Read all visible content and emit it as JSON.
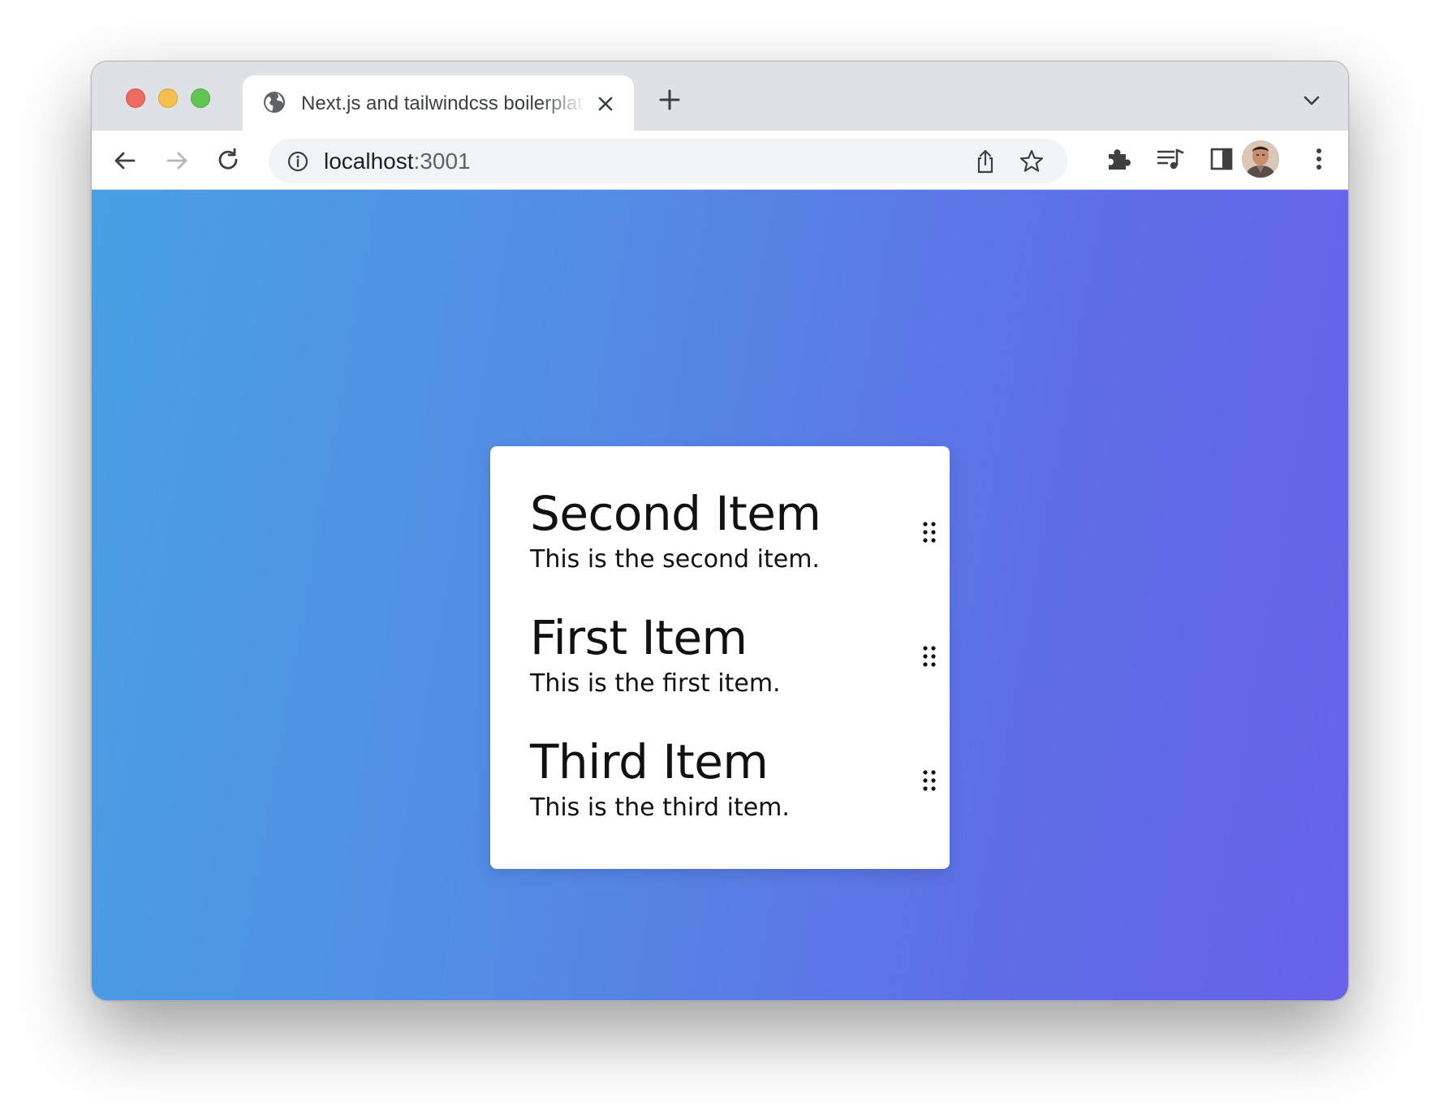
{
  "browser": {
    "tab": {
      "title": "Next.js and tailwindcss boilerplate",
      "icon": "globe-icon"
    },
    "toolbar": {
      "url_host": "localhost",
      "url_port": ":3001",
      "icons": [
        "back-arrow-icon",
        "forward-arrow-icon",
        "reload-icon",
        "info-icon",
        "share-icon",
        "star-icon",
        "extensions-icon",
        "media-queue-icon",
        "side-panel-icon",
        "more-vert-icon"
      ]
    }
  },
  "page": {
    "background_gradient": [
      "#49a0e3",
      "#548ae5",
      "#5f6de6",
      "#6762e9"
    ],
    "items": [
      {
        "title": "Second Item",
        "description": "This is the second item."
      },
      {
        "title": "First Item",
        "description": "This is the first item."
      },
      {
        "title": "Third Item",
        "description": "This is the third item."
      }
    ]
  }
}
